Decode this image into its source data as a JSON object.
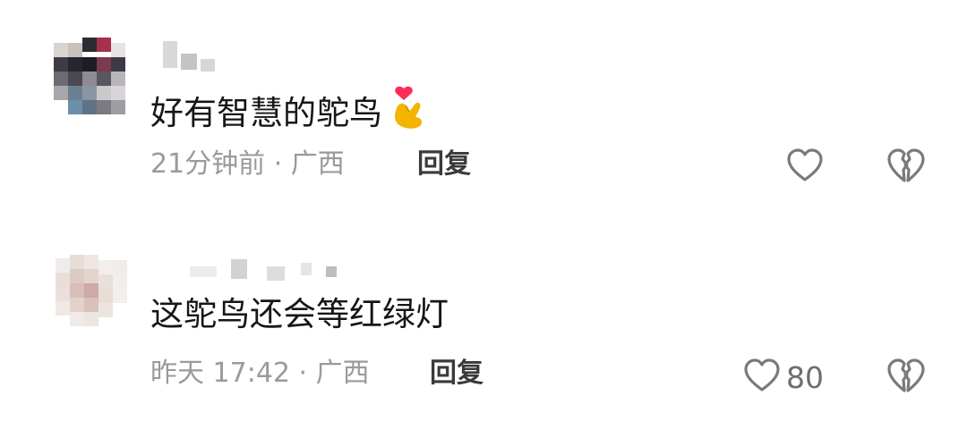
{
  "comments": [
    {
      "text": "好有智慧的鸵鸟",
      "emoji": "finger-heart-emoji",
      "meta": "21分钟前 · 广西",
      "reply_label": "回复",
      "like_count": null
    },
    {
      "text": "这鸵鸟还会等红绿灯",
      "meta": "昨天 17:42 · 广西",
      "reply_label": "回复",
      "like_count": "80"
    }
  ],
  "colors": {
    "text": "#161616",
    "meta": "#9a9a9a",
    "reply": "#3a3a3a",
    "icon": "#7a7a7a",
    "heart": "#ff2d55",
    "hand": "#f5b400"
  }
}
